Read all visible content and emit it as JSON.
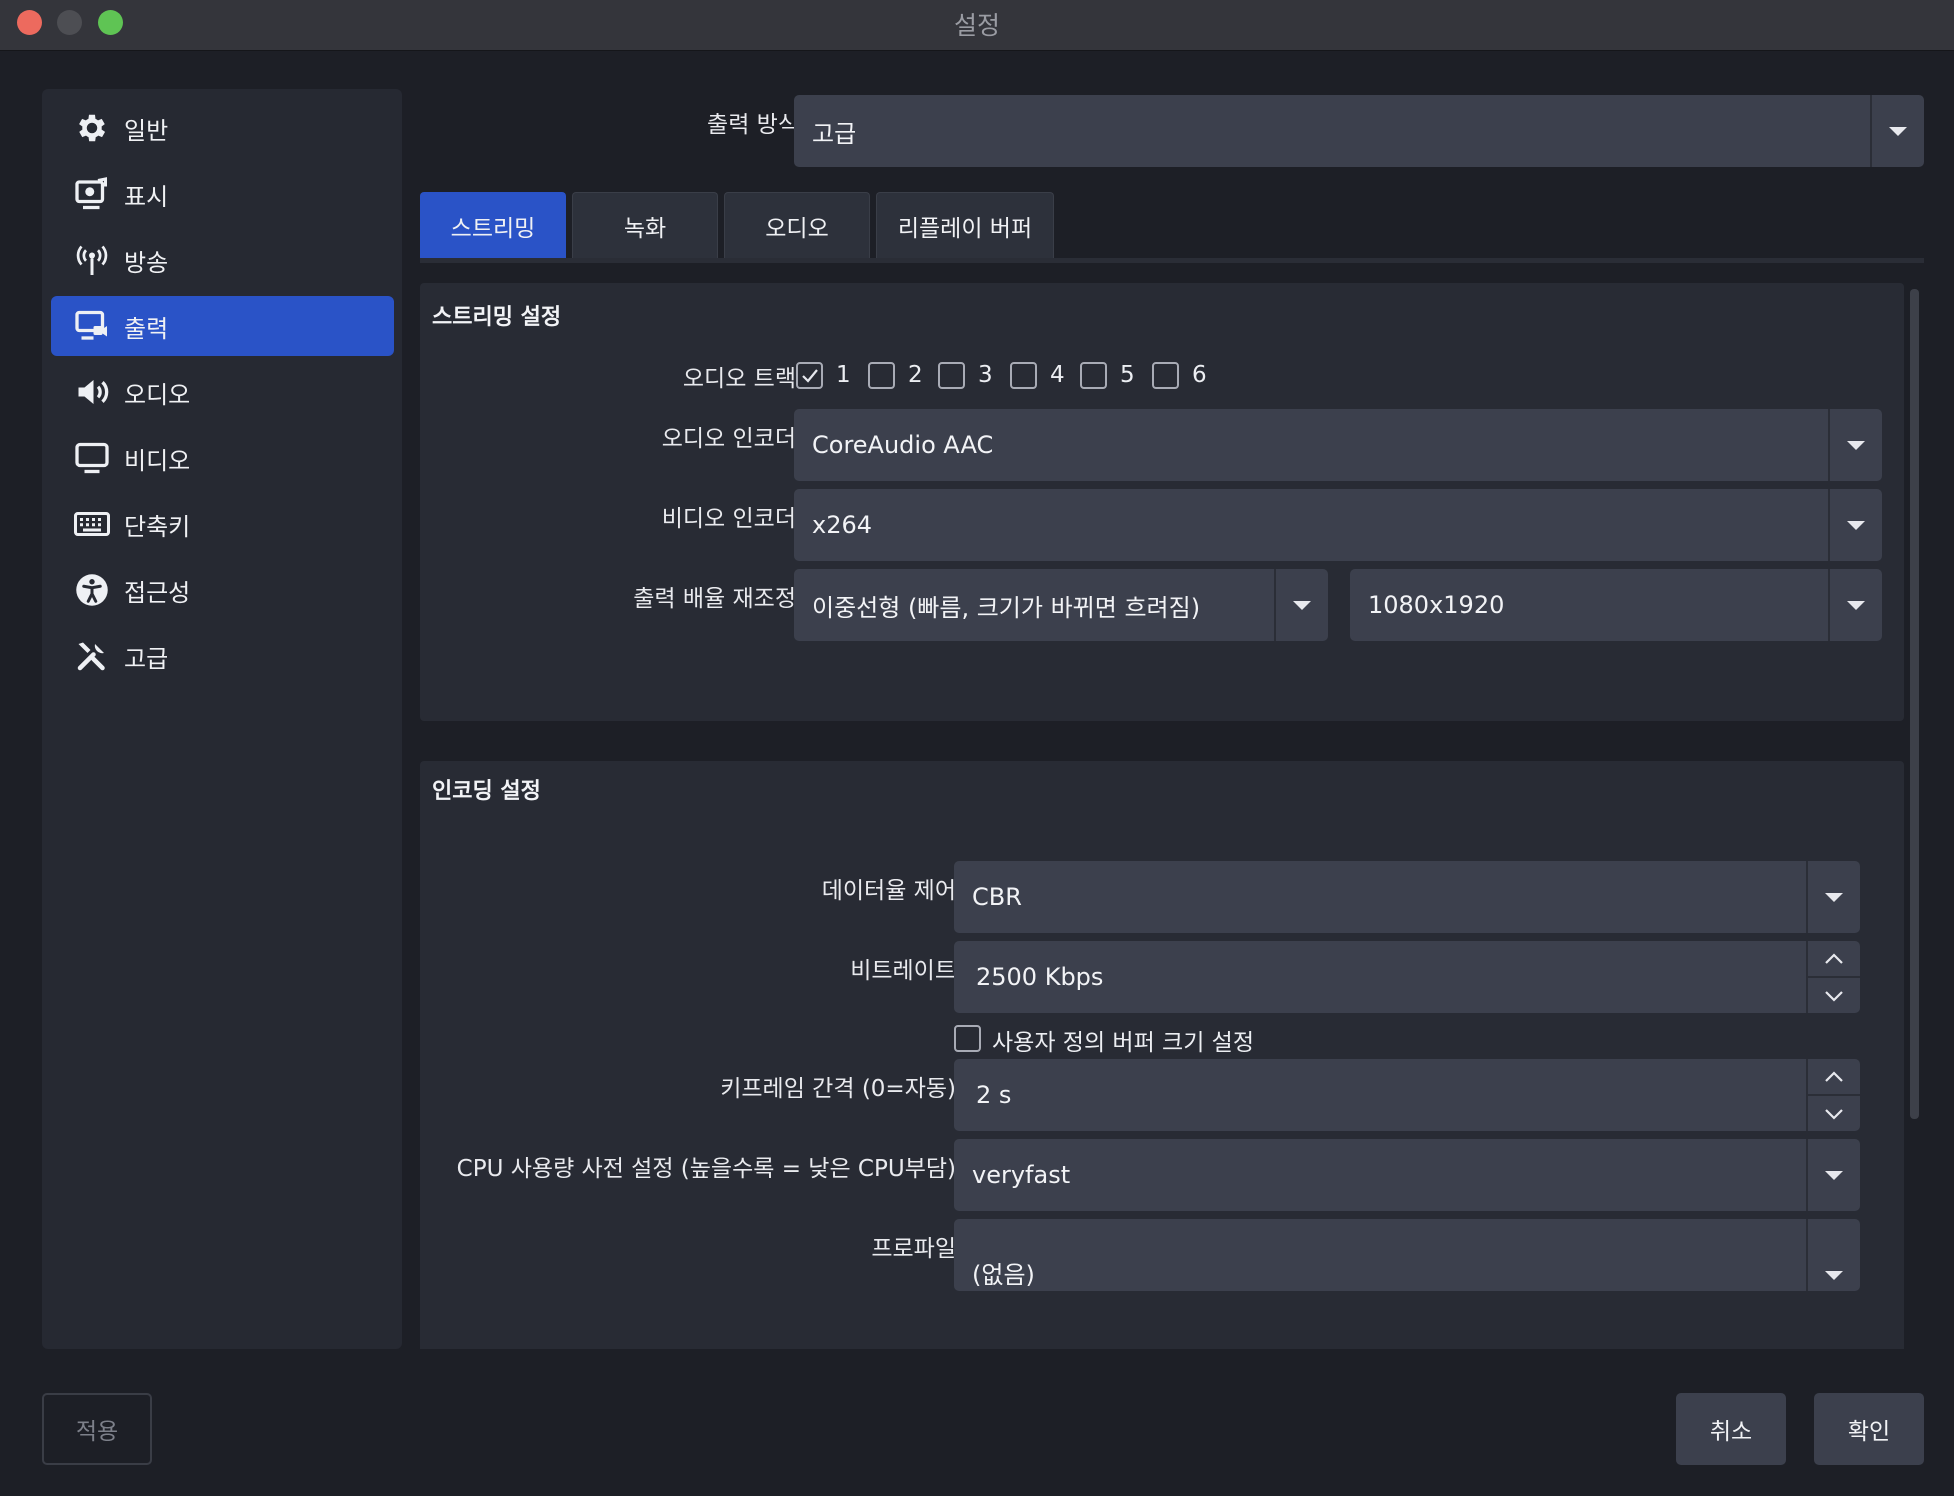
{
  "window": {
    "title": "설정"
  },
  "sidebar": {
    "items": [
      {
        "label": "일반",
        "icon": "gear-icon"
      },
      {
        "label": "표시",
        "icon": "display-icon"
      },
      {
        "label": "방송",
        "icon": "antenna-icon"
      },
      {
        "label": "출력",
        "icon": "output-icon",
        "active": true
      },
      {
        "label": "오디오",
        "icon": "speaker-icon"
      },
      {
        "label": "비디오",
        "icon": "monitor-icon"
      },
      {
        "label": "단축키",
        "icon": "keyboard-icon"
      },
      {
        "label": "접근성",
        "icon": "accessibility-icon"
      },
      {
        "label": "고급",
        "icon": "tools-icon"
      }
    ]
  },
  "output_mode": {
    "label": "출력 방식",
    "value": "고급"
  },
  "tabs": [
    {
      "label": "스트리밍",
      "active": true
    },
    {
      "label": "녹화"
    },
    {
      "label": "오디오"
    },
    {
      "label": "리플레이 버퍼"
    }
  ],
  "streaming": {
    "title": "스트리밍 설정",
    "audio_track": {
      "label": "오디오 트랙",
      "tracks": [
        {
          "label": "1",
          "checked": true
        },
        {
          "label": "2",
          "checked": false
        },
        {
          "label": "3",
          "checked": false
        },
        {
          "label": "4",
          "checked": false
        },
        {
          "label": "5",
          "checked": false
        },
        {
          "label": "6",
          "checked": false
        }
      ]
    },
    "audio_encoder": {
      "label": "오디오 인코더",
      "value": "CoreAudio AAC"
    },
    "video_encoder": {
      "label": "비디오 인코더",
      "value": "x264"
    },
    "rescale": {
      "label": "출력 배율 재조정",
      "filter": "이중선형 (빠름, 크기가 바뀌면 흐려짐)",
      "resolution": "1080x1920"
    }
  },
  "encoding": {
    "title": "인코딩 설정",
    "rate_control": {
      "label": "데이터율 제어",
      "value": "CBR"
    },
    "bitrate": {
      "label": "비트레이트",
      "value": "2500 Kbps"
    },
    "custom_buffer": {
      "label": "사용자 정의 버퍼 크기 설정",
      "checked": false
    },
    "keyframe": {
      "label": "키프레임 간격 (0=자동)",
      "value": "2 s"
    },
    "cpu_preset": {
      "label": "CPU 사용량 사전 설정 (높을수록 = 낮은 CPU부담)",
      "value": "veryfast"
    },
    "profile": {
      "label": "프로파일",
      "value": "(없음)"
    }
  },
  "buttons": {
    "apply": "적용",
    "cancel": "취소",
    "ok": "확인"
  },
  "colors": {
    "accent": "#2a53c7",
    "background": "#1d1f26",
    "panel": "#262932",
    "field": "#3c404d"
  }
}
